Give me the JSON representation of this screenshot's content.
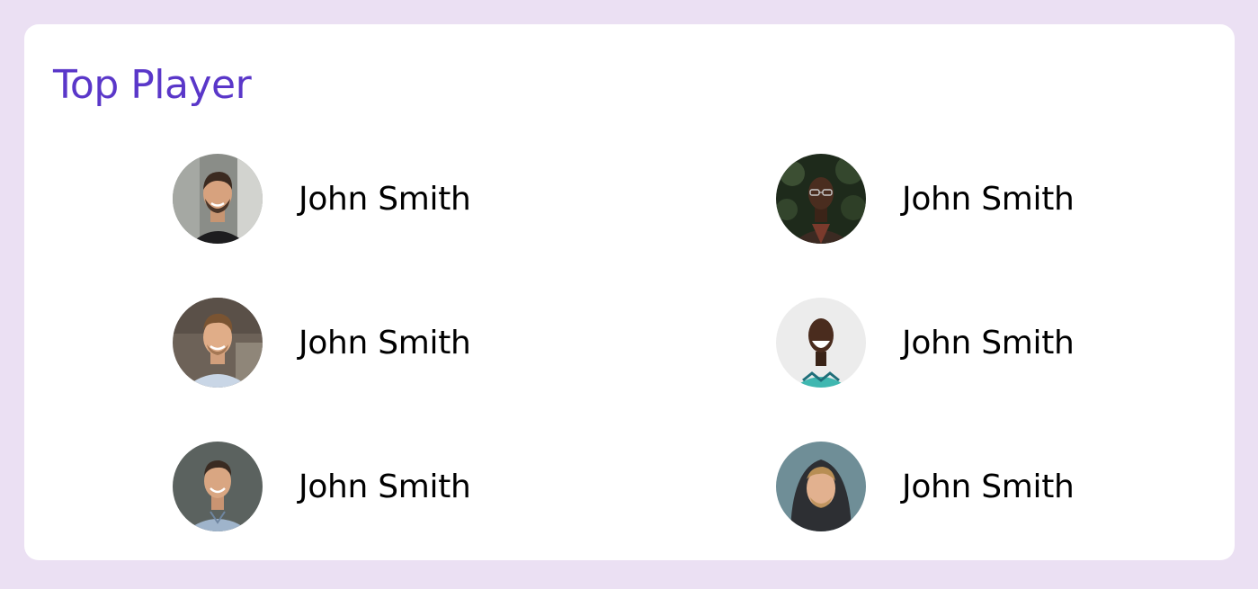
{
  "theme": {
    "background": "#ebe0f3",
    "card": "#ffffff",
    "accent": "#5a37c9",
    "text": "#000000"
  },
  "header": {
    "title": "Top Player"
  },
  "players": [
    {
      "name": "John Smith",
      "avatar_icon": "man-beard-portrait"
    },
    {
      "name": "John Smith",
      "avatar_icon": "man-glasses-portrait"
    },
    {
      "name": "John Smith",
      "avatar_icon": "man-smiling-portrait"
    },
    {
      "name": "John Smith",
      "avatar_icon": "man-laughing-portrait"
    },
    {
      "name": "John Smith",
      "avatar_icon": "man-shirt-portrait"
    },
    {
      "name": "John Smith",
      "avatar_icon": "man-hood-portrait"
    }
  ]
}
